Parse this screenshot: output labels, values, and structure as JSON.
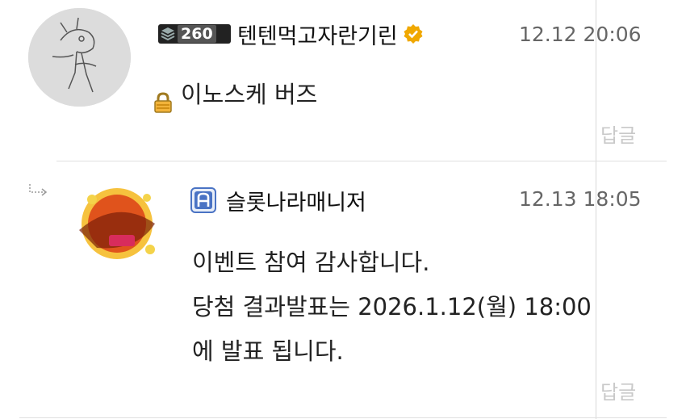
{
  "comments": [
    {
      "level": "260",
      "author": "텐텐먹고자란기린",
      "time": "12.12 20:06",
      "text": "이노스케 버즈",
      "reply_label": "답글",
      "icons": {
        "level": "level-badge-icon",
        "verified": "verified-badge-icon",
        "secret": "lock-icon"
      }
    },
    {
      "author": "슬롯나라매니저",
      "time": "12.13 18:05",
      "lines": [
        "이벤트 참여 감사합니다.",
        "당첨 결과발표는 2026.1.12(월) 18:00",
        "에 발표 됩니다."
      ],
      "reply_label": "답글",
      "icons": {
        "role": "admin-badge-icon",
        "reply": "reply-arrow-icon"
      }
    }
  ],
  "colors": {
    "verified": "#f0a800",
    "admin_badge": "#4a73c4",
    "reply_link": "#c9c9c9"
  }
}
